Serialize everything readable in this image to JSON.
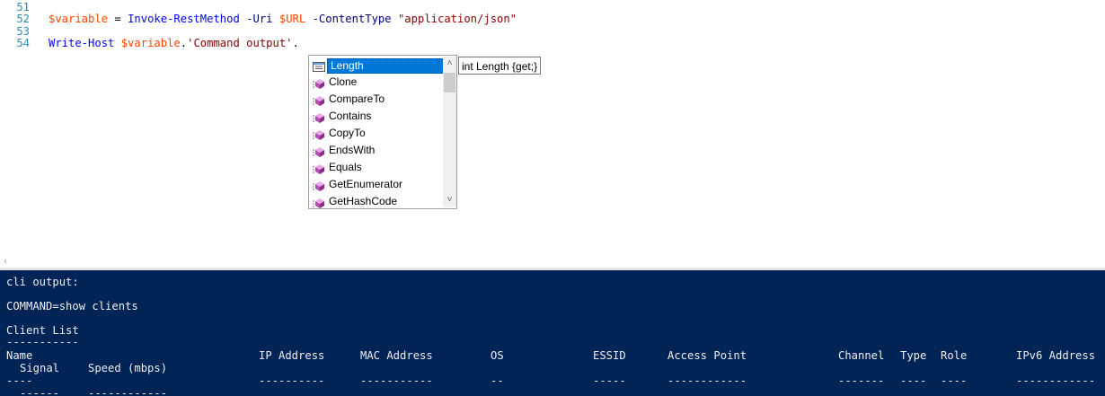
{
  "editor": {
    "lines": [
      {
        "num": "51"
      },
      {
        "num": "52",
        "tokens": [
          {
            "cls": "c-var",
            "text": "$variable"
          },
          {
            "cls": "c-plain",
            "text": " = "
          },
          {
            "cls": "c-cmd",
            "text": "Invoke-RestMethod"
          },
          {
            "cls": "c-plain",
            "text": " "
          },
          {
            "cls": "c-param",
            "text": "-Uri"
          },
          {
            "cls": "c-plain",
            "text": " "
          },
          {
            "cls": "c-var",
            "text": "$URL"
          },
          {
            "cls": "c-plain",
            "text": " "
          },
          {
            "cls": "c-param",
            "text": "-ContentType"
          },
          {
            "cls": "c-plain",
            "text": " "
          },
          {
            "cls": "c-str",
            "text": "\"application/json\""
          }
        ]
      },
      {
        "num": "53"
      },
      {
        "num": "54",
        "tokens": [
          {
            "cls": "c-cmd",
            "text": "Write-Host"
          },
          {
            "cls": "c-plain",
            "text": " "
          },
          {
            "cls": "c-var",
            "text": "$variable"
          },
          {
            "cls": "c-plain",
            "text": "."
          },
          {
            "cls": "c-str",
            "text": "'Command output'"
          },
          {
            "cls": "c-plain",
            "text": "."
          }
        ]
      }
    ]
  },
  "intellisense": {
    "items": [
      {
        "label": "Length",
        "icon": "property-icon",
        "selected": true
      },
      {
        "label": "Clone",
        "icon": "method-icon"
      },
      {
        "label": "CompareTo",
        "icon": "method-icon"
      },
      {
        "label": "Contains",
        "icon": "method-icon"
      },
      {
        "label": "CopyTo",
        "icon": "method-icon"
      },
      {
        "label": "EndsWith",
        "icon": "method-icon"
      },
      {
        "label": "Equals",
        "icon": "method-icon"
      },
      {
        "label": "GetEnumerator",
        "icon": "method-icon"
      },
      {
        "label": "GetHashCode",
        "icon": "method-icon"
      }
    ],
    "tooltip": "int Length {get;}"
  },
  "console": {
    "lines": [
      "cli output:",
      "",
      "COMMAND=show clients",
      "",
      "Client List",
      "-----------"
    ],
    "header_row": [
      "Name",
      "IP Address",
      "MAC Address",
      "OS",
      "ESSID",
      "Access Point",
      "Channel",
      "Type",
      "Role",
      "IPv6 Address"
    ],
    "dash_row": [
      "----",
      "----------",
      "-----------",
      "--",
      "-----",
      "------------",
      "-------",
      "----",
      "----",
      "------------"
    ],
    "header_row2": [
      "Signal",
      "Speed (mbps)"
    ],
    "dash_row2": [
      "------",
      "------------"
    ]
  }
}
